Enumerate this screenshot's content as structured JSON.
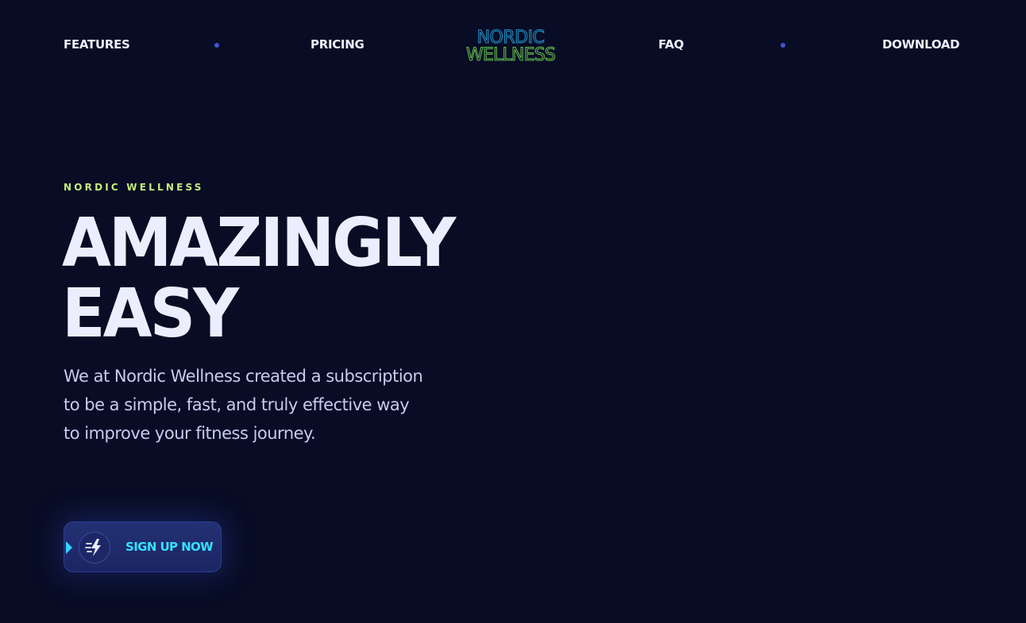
{
  "nav": {
    "features_label": "FEATURES",
    "pricing_label": "PRICING",
    "faq_label": "FAQ",
    "download_label": "DOWNLOAD"
  },
  "logo": {
    "line1": "NORDIC",
    "line2": "WELLNESS",
    "color_line1": "#1f8fc4",
    "color_line2": "#5fb84a"
  },
  "hero": {
    "eyebrow": "NORDIC WELLNESS",
    "headline_line1": "AMAZINGLY",
    "headline_line2": "EASY",
    "description": "We at Nordic Wellness created a subscription to be a simple, fast, and truly effective way to improve your fitness journey.",
    "cta_label": "SIGN UP NOW",
    "cta_icon": "lightning-speed-icon"
  },
  "colors": {
    "background": "#080c24",
    "accent": "#35e0ff",
    "eyebrow": "#c4ec7a",
    "dot": "#4154d6"
  }
}
